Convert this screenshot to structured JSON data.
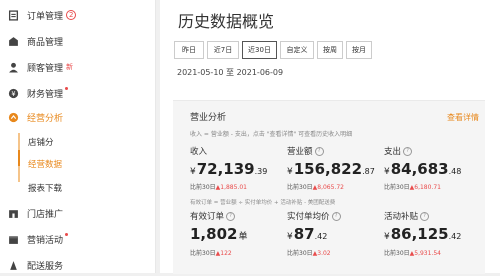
{
  "sidebar": {
    "items": [
      {
        "label": "订单管理",
        "badge": "2",
        "icon": "order-icon"
      },
      {
        "label": "商品管理",
        "icon": "goods-icon"
      },
      {
        "label": "顾客管理",
        "tag": "新",
        "icon": "customer-icon"
      },
      {
        "label": "财务管理",
        "icon": "finance-icon"
      },
      {
        "label": "经营分析",
        "icon": "analysis-icon"
      },
      {
        "label": "门店推广",
        "icon": "store-promo-icon"
      },
      {
        "label": "营销活动",
        "icon": "marketing-icon"
      },
      {
        "label": "配送服务",
        "icon": "delivery-icon"
      }
    ],
    "sub_items": [
      {
        "label": "店铺分"
      },
      {
        "label": "经营数据"
      },
      {
        "label": "报表下载"
      }
    ]
  },
  "page": {
    "title": "历史数据概览",
    "ranges": [
      "昨日",
      "近7日",
      "近30日",
      "自定义",
      "按周",
      "按月"
    ],
    "selected_range": "近30日",
    "date_range": "2021-05-10 至 2021-06-09"
  },
  "panel": {
    "title": "营业分析",
    "link": "查看详情",
    "desc": "收入 = 营业额 - 支出，点击 \"查看详情\" 可查看历史收入明细",
    "cmp_prefix": "比前30日",
    "metrics": [
      {
        "label": "收入",
        "currency": "¥",
        "int": "72,139",
        "dec": ".39",
        "unit": "",
        "change": "1,885.01",
        "help": false
      },
      {
        "label": "营业额",
        "currency": "¥",
        "int": "156,822",
        "dec": ".87",
        "unit": "",
        "change": "8,065.72",
        "help": true
      },
      {
        "label": "支出",
        "currency": "¥",
        "int": "84,683",
        "dec": ".48",
        "unit": "",
        "change": "6,180.71",
        "help": true
      },
      {
        "label": "有效订单",
        "currency": "",
        "int": "1,802",
        "dec": "",
        "unit": "单",
        "change": "122",
        "help": true
      },
      {
        "label": "实付单均价",
        "currency": "¥",
        "int": "87",
        "dec": ".42",
        "unit": "",
        "change": "3.02",
        "help": true
      },
      {
        "label": "活动补贴",
        "currency": "¥",
        "int": "86,125",
        "dec": ".42",
        "unit": "",
        "change": "5,931.54",
        "help": true
      }
    ],
    "desc2": "有效订单 = 营业额 ÷ 实付单均价 + 活动补贴 - 美团配送费"
  },
  "colors": {
    "accent": "#e8881c",
    "badge": "#e94b4b"
  }
}
